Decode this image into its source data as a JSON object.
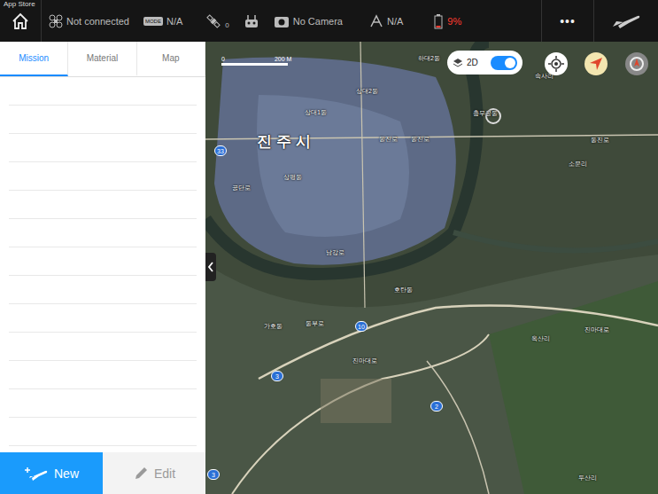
{
  "status_bar": {
    "back_label": "App Store"
  },
  "top_bar": {
    "aircraft": "Not connected",
    "mode_badge": "MODE",
    "mode": "N/A",
    "satellites": "0",
    "camera": "No Camera",
    "signal": "N/A",
    "battery": "9%",
    "more": "•••"
  },
  "tabs": [
    {
      "label": "Mission",
      "selected": true
    },
    {
      "label": "Material",
      "selected": false
    },
    {
      "label": "Map",
      "selected": false
    }
  ],
  "buttons": [
    {
      "label": "New",
      "disabled": false
    },
    {
      "label": "Edit",
      "disabled": true
    }
  ],
  "map": {
    "view_toggle": {
      "label": "2D",
      "on": true
    },
    "scale": {
      "start": "0",
      "end": "200 M"
    },
    "city_label": "진주시",
    "labels": [
      "하대2동",
      "상대2동",
      "상대1동",
      "동진로",
      "동진로",
      "충무공동",
      "속사리",
      "소문리",
      "동진로",
      "상평동",
      "공단로",
      "남강로",
      "호탄동",
      "가호동",
      "동부로",
      "진마대로",
      "옥산리",
      "진마대로",
      "두산리"
    ],
    "route_shields": [
      "33",
      "10",
      "3",
      "2",
      "3"
    ]
  }
}
